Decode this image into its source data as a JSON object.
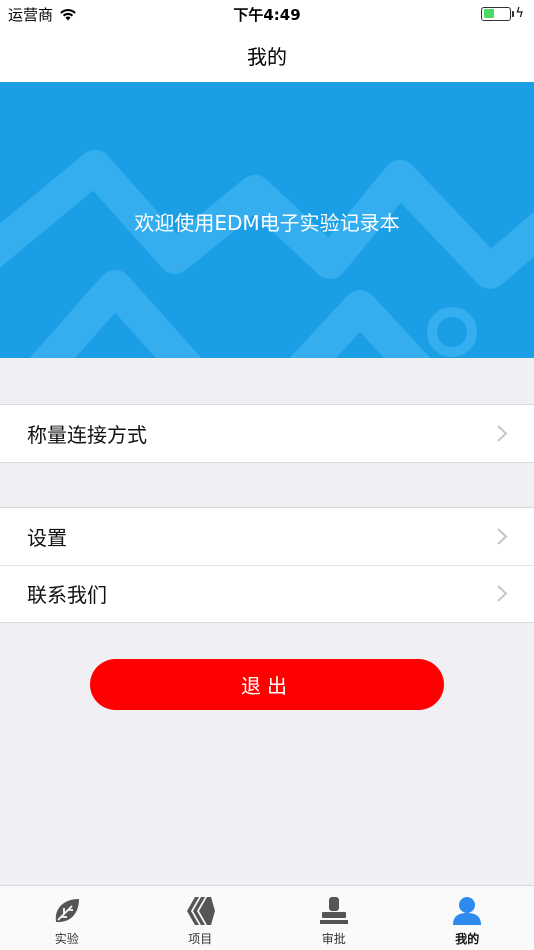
{
  "status_bar": {
    "carrier": "运营商",
    "time": "下午4:49",
    "battery_level": 0.4
  },
  "nav": {
    "title": "我的"
  },
  "banner": {
    "text": "欢迎使用EDM电子实验记录本"
  },
  "groups": [
    {
      "items": [
        {
          "label": "称量连接方式"
        }
      ]
    },
    {
      "items": [
        {
          "label": "设置"
        },
        {
          "label": "联系我们"
        }
      ]
    }
  ],
  "logout": {
    "label": "退出"
  },
  "tabs": [
    {
      "label": "实验",
      "icon": "leaf-icon"
    },
    {
      "label": "项目",
      "icon": "layers-icon"
    },
    {
      "label": "审批",
      "icon": "stamp-icon"
    },
    {
      "label": "我的",
      "icon": "user-icon",
      "active": true
    }
  ],
  "colors": {
    "banner": "#1a9fe6",
    "logout": "#ff0000",
    "active_tab": "#2d8bf0"
  }
}
